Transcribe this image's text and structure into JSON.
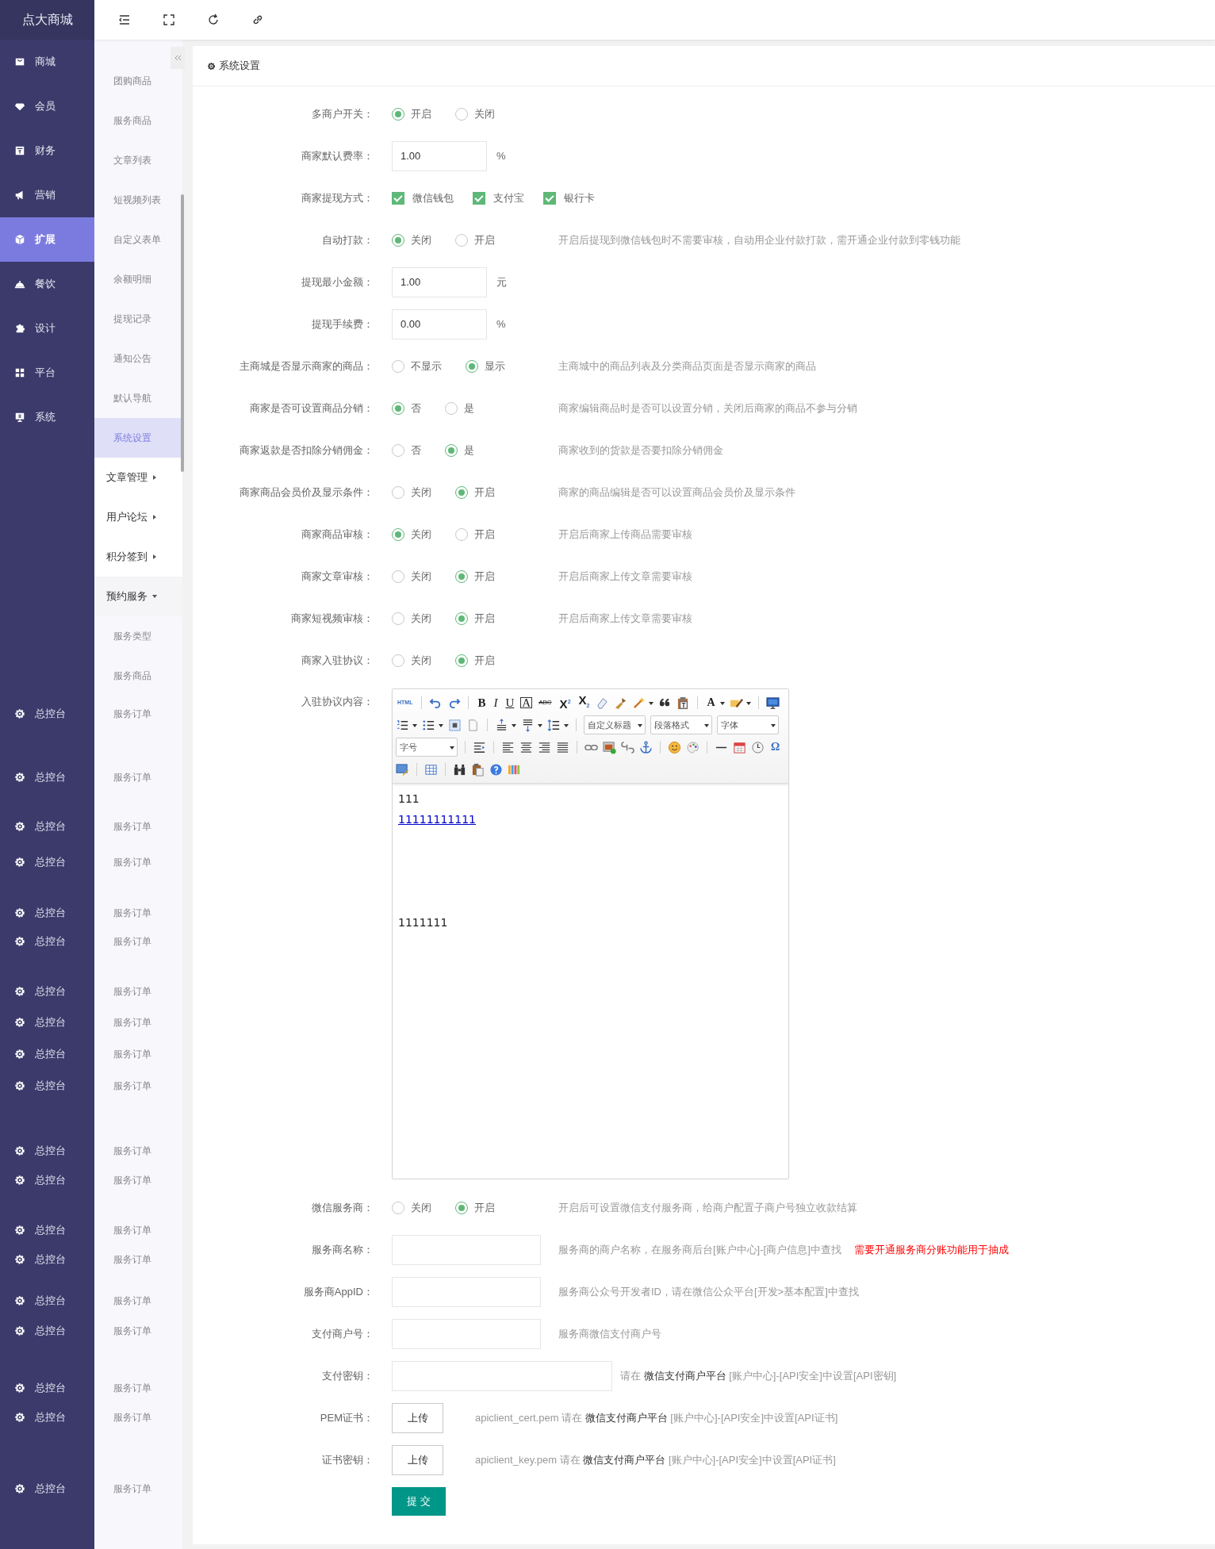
{
  "brand": "点大商城",
  "sidebar": {
    "items": [
      {
        "label": "商城",
        "selected": false
      },
      {
        "label": "会员",
        "selected": false
      },
      {
        "label": "财务",
        "selected": false
      },
      {
        "label": "营销",
        "selected": false
      },
      {
        "label": "扩展",
        "selected": true
      },
      {
        "label": "餐饮",
        "selected": false
      },
      {
        "label": "设计",
        "selected": false
      },
      {
        "label": "平台",
        "selected": false
      },
      {
        "label": "系统",
        "selected": false
      }
    ],
    "lower_items": [
      "总控台",
      "总控台",
      "总控台",
      "总控台",
      "总控台",
      "总控台",
      "总控台",
      "总控台",
      "总控台",
      "总控台",
      "总控台",
      "总控台",
      "总控台",
      "总控台",
      "总控台",
      "总控台",
      "总控台",
      "总控台",
      "总控台"
    ]
  },
  "submenu": {
    "items": [
      {
        "label": "团购商品",
        "selected": false
      },
      {
        "label": "服务商品",
        "selected": false
      },
      {
        "label": "文章列表",
        "selected": false
      },
      {
        "label": "短视频列表",
        "selected": false
      },
      {
        "label": "自定义表单",
        "selected": false
      },
      {
        "label": "余额明细",
        "selected": false
      },
      {
        "label": "提现记录",
        "selected": false
      },
      {
        "label": "通知公告",
        "selected": false
      },
      {
        "label": "默认导航",
        "selected": false
      },
      {
        "label": "系统设置",
        "selected": true
      }
    ],
    "groups": [
      {
        "label": "文章管理",
        "expanded": false
      },
      {
        "label": "用户论坛",
        "expanded": false
      },
      {
        "label": "积分签到",
        "expanded": false
      },
      {
        "label": "预约服务",
        "expanded": true,
        "children": [
          {
            "label": "服务类型",
            "selected": false
          },
          {
            "label": "服务商品",
            "selected": false
          },
          {
            "label": "服务订单",
            "selected": false
          },
          {
            "label": "服务订单",
            "selected": false
          },
          {
            "label": "服务订单",
            "selected": false
          },
          {
            "label": "服务订单",
            "selected": false
          },
          {
            "label": "服务订单",
            "selected": false
          },
          {
            "label": "服务订单",
            "selected": false
          },
          {
            "label": "服务订单",
            "selected": false
          },
          {
            "label": "服务订单",
            "selected": false
          },
          {
            "label": "服务订单",
            "selected": false
          },
          {
            "label": "服务订单",
            "selected": false
          },
          {
            "label": "服务订单",
            "selected": false
          },
          {
            "label": "服务订单",
            "selected": false
          },
          {
            "label": "服务订单",
            "selected": false
          },
          {
            "label": "服务订单",
            "selected": false
          },
          {
            "label": "服务订单",
            "selected": false
          },
          {
            "label": "服务订单",
            "selected": false
          },
          {
            "label": "服务订单",
            "selected": false
          },
          {
            "label": "服务订单",
            "selected": false
          },
          {
            "label": "服务订单",
            "selected": false
          }
        ]
      }
    ]
  },
  "panel": {
    "title": "系统设置",
    "fields": [
      {
        "kind": "radio",
        "label": "多商户开关：",
        "options": [
          {
            "label": "开启",
            "selected": true
          },
          {
            "label": "关闭",
            "selected": false
          }
        ]
      },
      {
        "kind": "input",
        "label": "商家默认费率：",
        "value": "1.00",
        "unit": "%"
      },
      {
        "kind": "checkbox",
        "label": "商家提现方式：",
        "options": [
          {
            "label": "微信钱包",
            "checked": true
          },
          {
            "label": "支付宝",
            "checked": true
          },
          {
            "label": "银行卡",
            "checked": true
          }
        ]
      },
      {
        "kind": "radio",
        "label": "自动打款：",
        "options": [
          {
            "label": "关闭",
            "selected": true
          },
          {
            "label": "开启",
            "selected": false
          }
        ],
        "hint": "开启后提现到微信钱包时不需要审核，自动用企业付款打款，需开通企业付款到零钱功能"
      },
      {
        "kind": "input",
        "label": "提现最小金额：",
        "value": "1.00",
        "unit": "元"
      },
      {
        "kind": "input",
        "label": "提现手续费：",
        "value": "0.00",
        "unit": "%"
      },
      {
        "kind": "radio",
        "label": "主商城是否显示商家的商品：",
        "options": [
          {
            "label": "不显示",
            "selected": false
          },
          {
            "label": "显示",
            "selected": true
          }
        ],
        "hint": "主商城中的商品列表及分类商品页面是否显示商家的商品"
      },
      {
        "kind": "radio",
        "label": "商家是否可设置商品分销：",
        "options": [
          {
            "label": "否",
            "selected": true
          },
          {
            "label": "是",
            "selected": false
          }
        ],
        "hint": "商家编辑商品时是否可以设置分销，关闭后商家的商品不参与分销"
      },
      {
        "kind": "radio",
        "label": "商家返款是否扣除分销佣金：",
        "options": [
          {
            "label": "否",
            "selected": false
          },
          {
            "label": "是",
            "selected": true
          }
        ],
        "hint": "商家收到的货款是否要扣除分销佣金"
      },
      {
        "kind": "radio",
        "label": "商家商品会员价及显示条件：",
        "options": [
          {
            "label": "关闭",
            "selected": false
          },
          {
            "label": "开启",
            "selected": true
          }
        ],
        "hint": "商家的商品编辑是否可以设置商品会员价及显示条件"
      },
      {
        "kind": "radio",
        "label": "商家商品审核：",
        "options": [
          {
            "label": "关闭",
            "selected": true
          },
          {
            "label": "开启",
            "selected": false
          }
        ],
        "hint": "开启后商家上传商品需要审核"
      },
      {
        "kind": "radio",
        "label": "商家文章审核：",
        "options": [
          {
            "label": "关闭",
            "selected": false
          },
          {
            "label": "开启",
            "selected": true
          }
        ],
        "hint": "开启后商家上传文章需要审核"
      },
      {
        "kind": "radio",
        "label": "商家短视频审核：",
        "options": [
          {
            "label": "关闭",
            "selected": false
          },
          {
            "label": "开启",
            "selected": true
          }
        ],
        "hint": "开启后商家上传文章需要审核"
      },
      {
        "kind": "radio",
        "label": "商家入驻协议：",
        "options": [
          {
            "label": "关闭",
            "selected": false
          },
          {
            "label": "开启",
            "selected": true
          }
        ]
      },
      {
        "kind": "editor",
        "label": "入驻协议内容：",
        "toolbar_texts": [
          "HTML",
          "B",
          "I",
          "U",
          "A",
          "ABC",
          "X$^{2}$",
          "X$_{2}$",
          "A",
          "Ω"
        ],
        "selects": [
          "自定义标题",
          "段落格式",
          "字体",
          "字号"
        ],
        "content": [
          {
            "kind": "text",
            "text": "111"
          },
          {
            "kind": "link",
            "text": "11111111111"
          },
          {
            "kind": "blank"
          },
          {
            "kind": "blank"
          },
          {
            "kind": "blank"
          },
          {
            "kind": "blank"
          },
          {
            "kind": "text",
            "text": "1111111"
          }
        ]
      },
      {
        "kind": "radio",
        "label": "微信服务商：",
        "options": [
          {
            "label": "关闭",
            "selected": false
          },
          {
            "label": "开启",
            "selected": true
          }
        ],
        "hint": "开启后可设置微信支付服务商，给商户配置子商户号独立收款结算"
      },
      {
        "kind": "input",
        "label": "服务商名称：",
        "hint": "服务商的商户名称，在服务商后台[账户中心]-[商户信息]中查找",
        "note": "需要开通服务商分账功能用于抽成"
      },
      {
        "kind": "input",
        "label": "服务商AppID：",
        "hint": "服务商公众号开发者ID，请在微信公众平台[开发>基本配置]中查找"
      },
      {
        "kind": "input",
        "label": "支付商户号：",
        "hint": "服务商微信支付商户号"
      },
      {
        "kind": "password",
        "label": "支付密钥：",
        "hint": "请在 **微信支付商户平台** [账户中心]-[API安全]中设置[API密钥]"
      },
      {
        "kind": "upload",
        "label": "PEM证书：",
        "button": "上传",
        "hint": "apiclient_cert.pem 请在 **微信支付商户平台** [账户中心]-[API安全]中设置[API证书]"
      },
      {
        "kind": "upload",
        "label": "证书密钥：",
        "button": "上传",
        "hint": "apiclient_key.pem 请在 **微信支付商户平台** [账户中心]-[API安全]中设置[API证书]"
      }
    ],
    "submit": "提 交"
  }
}
